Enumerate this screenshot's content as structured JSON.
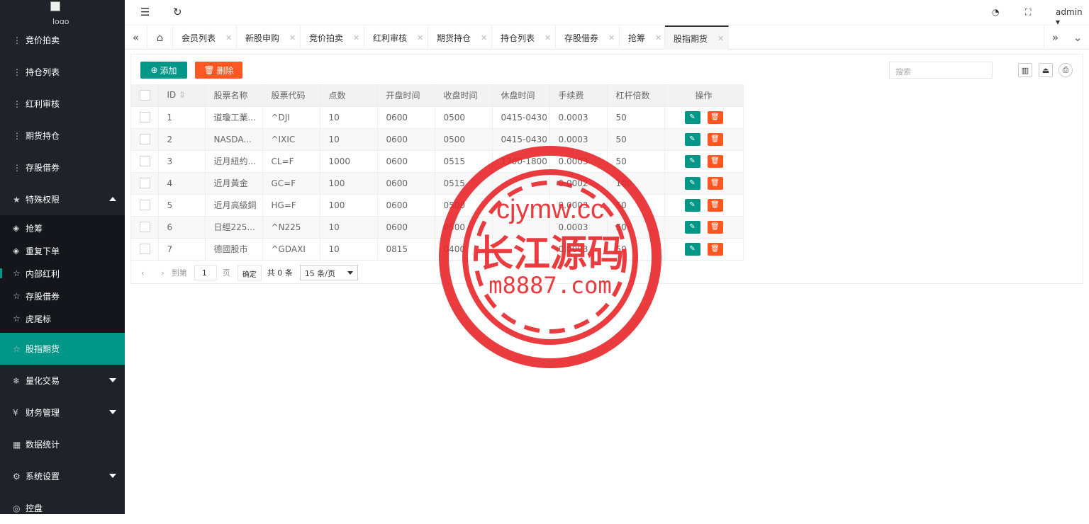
{
  "logo": {
    "alt": "logo"
  },
  "sidebar": {
    "top_items": [
      {
        "label": "竞价拍卖",
        "icon": "kebab-icon"
      },
      {
        "label": "持仓列表",
        "icon": "kebab-icon"
      },
      {
        "label": "红利审核",
        "icon": "kebab-icon"
      },
      {
        "label": "期货持仓",
        "icon": "kebab-icon"
      },
      {
        "label": "存股借券",
        "icon": "kebab-icon"
      }
    ],
    "group_special": {
      "label": "特殊权限",
      "icon": "star-icon"
    },
    "sub_items": [
      {
        "label": "抢筹",
        "icon": "diamond-icon"
      },
      {
        "label": "重复下单",
        "icon": "diamond-icon"
      },
      {
        "label": "内部红利",
        "icon": "star-outline-icon"
      },
      {
        "label": "存股借券",
        "icon": "star-outline-icon"
      },
      {
        "label": "虎尾标",
        "icon": "star-outline-icon"
      }
    ],
    "active_item": {
      "label": "股指期货",
      "icon": "star-outline-icon"
    },
    "bottom_items": [
      {
        "label": "量化交易",
        "icon": "snowflake-icon"
      },
      {
        "label": "财务管理",
        "icon": "yen-icon"
      },
      {
        "label": "数据统计",
        "icon": "calendar-icon"
      },
      {
        "label": "系统设置",
        "icon": "gear-icon"
      },
      {
        "label": "控盘",
        "icon": "compass-icon"
      }
    ]
  },
  "header": {
    "user": "admin"
  },
  "tabs": [
    "会员列表",
    "新股申购",
    "竞价拍卖",
    "红利审核",
    "期货持仓",
    "持仓列表",
    "存股借券",
    "抢筹",
    "股指期货"
  ],
  "toolbar": {
    "add_label": "添加",
    "delete_label": "删除",
    "search_placeholder": "搜索"
  },
  "table": {
    "headers": [
      "ID",
      "股票名称",
      "股票代码",
      "点数",
      "开盘时间",
      "收盘时间",
      "休盘时间",
      "手续费",
      "杠杆倍数",
      "操作"
    ],
    "rows": [
      [
        "1",
        "道瓊工業...",
        "^DJI",
        "10",
        "0600",
        "0500",
        "0415-0430",
        "0.0003",
        "50"
      ],
      [
        "2",
        "NASDA...",
        "^IXIC",
        "10",
        "0600",
        "0500",
        "0415-0430",
        "0.0003",
        "50"
      ],
      [
        "3",
        "近月紐約...",
        "CL=F",
        "1000",
        "0600",
        "0515",
        "1700-1800",
        "0.0003",
        "50"
      ],
      [
        "4",
        "近月黃金",
        "GC=F",
        "100",
        "0600",
        "0515",
        "",
        "0.0002",
        "100"
      ],
      [
        "5",
        "近月高級銅",
        "HG=F",
        "100",
        "0600",
        "0500",
        "",
        "0.0003",
        "50"
      ],
      [
        "6",
        "日經225...",
        "^N225",
        "10",
        "0600",
        "0500",
        "",
        "0.0003",
        "50"
      ],
      [
        "7",
        "德國股市",
        "^GDAXI",
        "10",
        "0815",
        "0400",
        "",
        "0.0003",
        "50"
      ]
    ]
  },
  "pager": {
    "goto": "到第",
    "page_value": "1",
    "page_unit": "页",
    "confirm": "确定",
    "total": "共 0 条",
    "per_page": "15 条/页"
  },
  "watermark": {
    "line1": "cjymw.cc",
    "line2": "长江源码",
    "line3": "m8887.com",
    "color": "#e8262b"
  }
}
